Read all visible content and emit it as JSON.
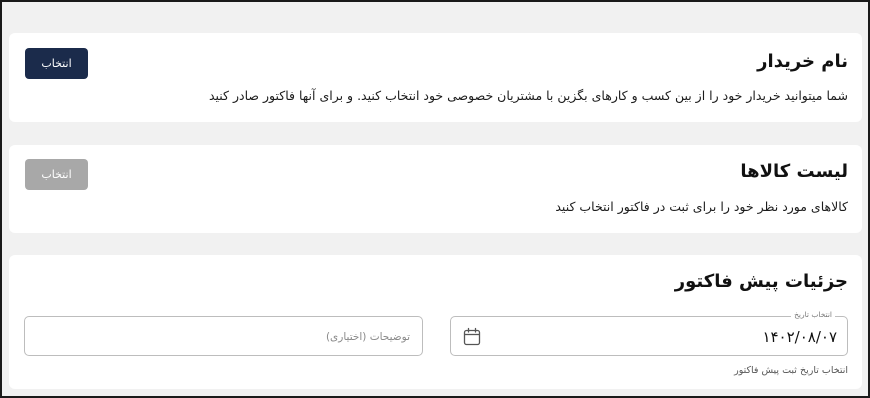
{
  "buyer": {
    "title": "نام خریدار",
    "description": "شما میتوانید خریدار خود را از بین کسب و کارهای بگزین با مشتریان خصوصی خود انتخاب کنید. و برای آنها فاکتور صادر کنید",
    "select_label": "انتخاب"
  },
  "products": {
    "title": "لیست کالاها",
    "description": "کالاهای مورد نظر خود را برای ثبت در فاکتور انتخاب کنید",
    "select_label": "انتخاب"
  },
  "invoice_details": {
    "title": "جزئیات پیش فاکتور",
    "notes_placeholder": "توضیحات (اختیاری)",
    "date_label": "انتخاب تاریخ",
    "date_value": "۱۴۰۲/۰۸/۰۷",
    "date_helper": "انتخاب تاریخ ثبت پیش فاکتور"
  },
  "icons": {
    "calendar": "calendar-icon"
  },
  "colors": {
    "primary_button": "#1b2b4b",
    "disabled_button": "#a8a8a8",
    "page_background": "#f1f1f1"
  }
}
